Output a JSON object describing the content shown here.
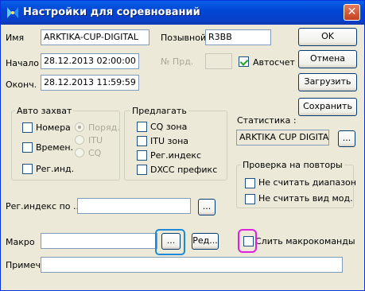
{
  "window": {
    "title": "Настройки для соревнований",
    "close_label": "✕"
  },
  "fields": {
    "name_label": "Имя",
    "name_value": "ARKTIKA-CUP-DIGITAL",
    "callsign_label": "Позывной",
    "callsign_value": "R3BB",
    "start_label": "Начало",
    "start_value": "28.12.2013 02:00:00",
    "prd_label": "№ Прд.",
    "prd_value": "",
    "end_label": "Оконч.",
    "end_value": "28.12.2013 11:59:59",
    "autocalc_label": "Автосчет",
    "autocalc_checked": true
  },
  "buttons": {
    "ok": "OK",
    "cancel": "Отмена",
    "load": "Загрузить",
    "save": "Сохранить",
    "edit": "Ред..."
  },
  "auto_capture": {
    "title": "Авто захват",
    "numbers": "Номера",
    "time": "Времен.",
    "reg_ind": "Рег.инд.",
    "radio_order": "Поряд.",
    "radio_itu": "ITU",
    "radio_cq": "CQ"
  },
  "offer": {
    "title": "Предлагать",
    "cq": "CQ зона",
    "itu": "ITU зона",
    "reg": "Рег.индекс",
    "dxcc": "DXCC префикс"
  },
  "statistics": {
    "label": "Статистика :",
    "value": "ARKTIKA CUP DIGITA",
    "browse": "..."
  },
  "repeat_check": {
    "title": "Проверка на повторы",
    "ignore_range": "Не считать диапазон",
    "ignore_mode": "Не считать вид мод."
  },
  "regindex": {
    "label": "Рег.индекс по ...",
    "value": "",
    "browse": "..."
  },
  "macro": {
    "label": "Макро",
    "value": "",
    "browse": "...",
    "merge_label": "Слить макрокоманды"
  },
  "note": {
    "label": "Примеч.",
    "value": ""
  },
  "colors": {
    "title_bar": "#0a5fe8",
    "dialog_bg": "#ece9d8",
    "check_mark": "#21a121",
    "blue_highlight": "#1c8ad9",
    "magenta_highlight": "#e020e0"
  }
}
